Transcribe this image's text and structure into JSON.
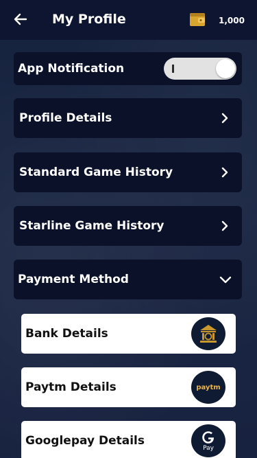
{
  "header": {
    "title": "My Profile",
    "balance": "1,000",
    "back_icon": "arrow-left-icon",
    "wallet_icon": "wallet-icon"
  },
  "settings": {
    "app_notification": {
      "label": "App Notification",
      "enabled": true
    },
    "menu": [
      {
        "label": "Profile Details",
        "icon": "chevron-right-icon"
      },
      {
        "label": "Standard Game History",
        "icon": "chevron-right-icon"
      },
      {
        "label": "Starline Game History",
        "icon": "chevron-right-icon"
      }
    ],
    "payment_method": {
      "label": "Payment Method",
      "expanded": true,
      "icon": "chevron-down-icon",
      "options": [
        {
          "label": "Bank Details",
          "logo": "bank-icon"
        },
        {
          "label": "Paytm Details",
          "logo": "paytm-icon",
          "logo_text": "paytm"
        },
        {
          "label": "Googlepay Details",
          "logo": "google-pay-icon",
          "logo_text": "Pay"
        }
      ]
    }
  },
  "colors": {
    "header_bg": "#0d1530",
    "card_bg": "#0b1129",
    "page_bg": "#1b2744",
    "accent_gold": "#c8982f"
  }
}
